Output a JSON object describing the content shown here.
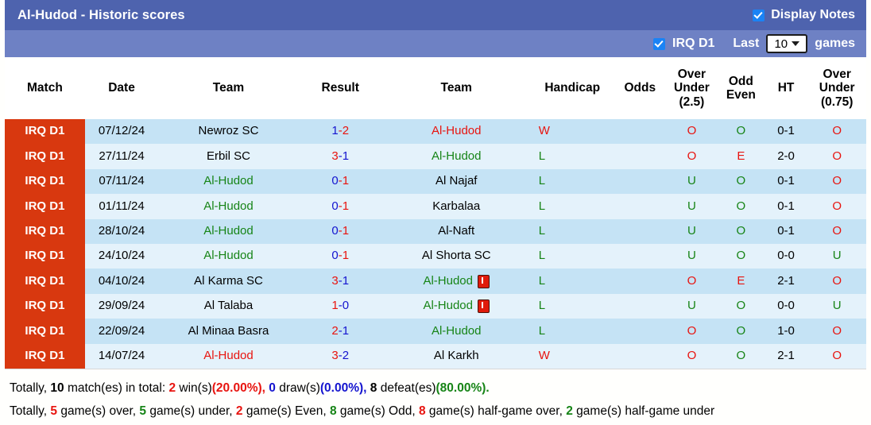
{
  "header": {
    "title": "Al-Hudod - Historic scores",
    "display_notes_label": "Display Notes",
    "display_notes_checked": true,
    "league_filter_label": "IRQ D1",
    "league_filter_checked": true,
    "last_label": "Last",
    "games_label": "games",
    "games_count": "10",
    "title_bar_color": "#4e63ae",
    "filter_bar_color": "#6e81c4",
    "checkbox_color": "#1a83f5"
  },
  "table": {
    "columns": [
      "Match",
      "Date",
      "Team",
      "Result",
      "Team",
      "Handicap",
      "Odds",
      "Over\nUnder\n(2.5)",
      "Odd\nEven",
      "HT",
      "Over\nUnder\n(0.75)"
    ],
    "column_headers": {
      "match": "Match",
      "date": "Date",
      "team_home": "Team",
      "result": "Result",
      "team_away": "Team",
      "handicap": "Handicap",
      "odds": "Odds",
      "over_under_25_l1": "Over",
      "over_under_25_l2": "Under",
      "over_under_25_l3": "(2.5)",
      "odd_even_l1": "Odd",
      "odd_even_l2": "Even",
      "ht": "HT",
      "over_under_075_l1": "Over",
      "over_under_075_l2": "Under",
      "over_under_075_l3": "(0.75)"
    },
    "league_badge_color": "#d8380f",
    "rows": [
      {
        "league": "IRQ D1",
        "date": "07/12/24",
        "home": "Newroz SC",
        "home_color": "black",
        "home_card": false,
        "score_home": "1",
        "score_sep": "-",
        "score_away": "2",
        "score_home_color": "blue",
        "score_away_color": "red",
        "away": "Al-Hudod",
        "away_color": "red",
        "away_card": false,
        "handicap": "",
        "odds": "",
        "wl": "W",
        "wl_color": "red",
        "ou25": "O",
        "ou25_color": "red",
        "oddeven": "O",
        "oddeven_color": "green",
        "ht": "0-1",
        "ht_color": "black",
        "ou075": "O",
        "ou075_color": "red"
      },
      {
        "league": "IRQ D1",
        "date": "27/11/24",
        "home": "Erbil SC",
        "home_color": "black",
        "home_card": false,
        "score_home": "3",
        "score_sep": "-",
        "score_away": "1",
        "score_home_color": "red",
        "score_away_color": "blue",
        "away": "Al-Hudod",
        "away_color": "green",
        "away_card": false,
        "handicap": "",
        "odds": "",
        "wl": "L",
        "wl_color": "green",
        "ou25": "O",
        "ou25_color": "red",
        "oddeven": "E",
        "oddeven_color": "red",
        "ht": "2-0",
        "ht_color": "black",
        "ou075": "O",
        "ou075_color": "red"
      },
      {
        "league": "IRQ D1",
        "date": "07/11/24",
        "home": "Al-Hudod",
        "home_color": "green",
        "home_card": false,
        "score_home": "0",
        "score_sep": "-",
        "score_away": "1",
        "score_home_color": "blue",
        "score_away_color": "red",
        "away": "Al Najaf",
        "away_color": "black",
        "away_card": false,
        "handicap": "",
        "odds": "",
        "wl": "L",
        "wl_color": "green",
        "ou25": "U",
        "ou25_color": "green",
        "oddeven": "O",
        "oddeven_color": "green",
        "ht": "0-1",
        "ht_color": "black",
        "ou075": "O",
        "ou075_color": "red"
      },
      {
        "league": "IRQ D1",
        "date": "01/11/24",
        "home": "Al-Hudod",
        "home_color": "green",
        "home_card": false,
        "score_home": "0",
        "score_sep": "-",
        "score_away": "1",
        "score_home_color": "blue",
        "score_away_color": "red",
        "away": "Karbalaa",
        "away_color": "black",
        "away_card": false,
        "handicap": "",
        "odds": "",
        "wl": "L",
        "wl_color": "green",
        "ou25": "U",
        "ou25_color": "green",
        "oddeven": "O",
        "oddeven_color": "green",
        "ht": "0-1",
        "ht_color": "black",
        "ou075": "O",
        "ou075_color": "red"
      },
      {
        "league": "IRQ D1",
        "date": "28/10/24",
        "home": "Al-Hudod",
        "home_color": "green",
        "home_card": false,
        "score_home": "0",
        "score_sep": "-",
        "score_away": "1",
        "score_home_color": "blue",
        "score_away_color": "red",
        "away": "Al-Naft",
        "away_color": "black",
        "away_card": false,
        "handicap": "",
        "odds": "",
        "wl": "L",
        "wl_color": "green",
        "ou25": "U",
        "ou25_color": "green",
        "oddeven": "O",
        "oddeven_color": "green",
        "ht": "0-1",
        "ht_color": "black",
        "ou075": "O",
        "ou075_color": "red"
      },
      {
        "league": "IRQ D1",
        "date": "24/10/24",
        "home": "Al-Hudod",
        "home_color": "green",
        "home_card": false,
        "score_home": "0",
        "score_sep": "-",
        "score_away": "1",
        "score_home_color": "blue",
        "score_away_color": "red",
        "away": "Al Shorta SC",
        "away_color": "black",
        "away_card": false,
        "handicap": "",
        "odds": "",
        "wl": "L",
        "wl_color": "green",
        "ou25": "U",
        "ou25_color": "green",
        "oddeven": "O",
        "oddeven_color": "green",
        "ht": "0-0",
        "ht_color": "black",
        "ou075": "U",
        "ou075_color": "green"
      },
      {
        "league": "IRQ D1",
        "date": "04/10/24",
        "home": "Al Karma SC",
        "home_color": "black",
        "home_card": false,
        "score_home": "3",
        "score_sep": "-",
        "score_away": "1",
        "score_home_color": "red",
        "score_away_color": "blue",
        "away": "Al-Hudod",
        "away_color": "green",
        "away_card": true,
        "handicap": "",
        "odds": "",
        "wl": "L",
        "wl_color": "green",
        "ou25": "O",
        "ou25_color": "red",
        "oddeven": "E",
        "oddeven_color": "red",
        "ht": "2-1",
        "ht_color": "black",
        "ou075": "O",
        "ou075_color": "red"
      },
      {
        "league": "IRQ D1",
        "date": "29/09/24",
        "home": "Al Talaba",
        "home_color": "black",
        "home_card": false,
        "score_home": "1",
        "score_sep": "-",
        "score_away": "0",
        "score_home_color": "red",
        "score_away_color": "blue",
        "away": "Al-Hudod",
        "away_color": "green",
        "away_card": true,
        "handicap": "",
        "odds": "",
        "wl": "L",
        "wl_color": "green",
        "ou25": "U",
        "ou25_color": "green",
        "oddeven": "O",
        "oddeven_color": "green",
        "ht": "0-0",
        "ht_color": "black",
        "ou075": "U",
        "ou075_color": "green"
      },
      {
        "league": "IRQ D1",
        "date": "22/09/24",
        "home": "Al Minaa Basra",
        "home_color": "black",
        "home_card": false,
        "score_home": "2",
        "score_sep": "-",
        "score_away": "1",
        "score_home_color": "red",
        "score_away_color": "blue",
        "away": "Al-Hudod",
        "away_color": "green",
        "away_card": false,
        "handicap": "",
        "odds": "",
        "wl": "L",
        "wl_color": "green",
        "ou25": "O",
        "ou25_color": "red",
        "oddeven": "O",
        "oddeven_color": "green",
        "ht": "1-0",
        "ht_color": "black",
        "ou075": "O",
        "ou075_color": "red"
      },
      {
        "league": "IRQ D1",
        "date": "14/07/24",
        "home": "Al-Hudod",
        "home_color": "red",
        "home_card": false,
        "score_home": "3",
        "score_sep": "-",
        "score_away": "2",
        "score_home_color": "red",
        "score_away_color": "blue",
        "away": "Al Karkh",
        "away_color": "black",
        "away_card": false,
        "handicap": "",
        "odds": "",
        "wl": "W",
        "wl_color": "red",
        "ou25": "O",
        "ou25_color": "red",
        "oddeven": "O",
        "oddeven_color": "green",
        "ht": "2-1",
        "ht_color": "black",
        "ou075": "O",
        "ou075_color": "red"
      }
    ]
  },
  "summary": {
    "line1": {
      "t1": "Totally,",
      "matches": "10",
      "t2": "match(es) in total:",
      "wins": "2",
      "t3": "win(s)",
      "wins_pct": "(20.00%),",
      "draws": "0",
      "t4": "draw(s)",
      "draws_pct": "(0.00%),",
      "defeats": "8",
      "t5": "defeat(es)",
      "defeats_pct": "(80.00%)."
    },
    "line2": {
      "t1": "Totally,",
      "over": "5",
      "t2": "game(s) over,",
      "under": "5",
      "t3": "game(s) under,",
      "even": "2",
      "t4": "game(s) Even,",
      "odd": "8",
      "t5": "game(s) Odd,",
      "half_over": "8",
      "t6": "game(s) half-game over,",
      "half_under": "2",
      "t7": "game(s) half-game under"
    }
  }
}
